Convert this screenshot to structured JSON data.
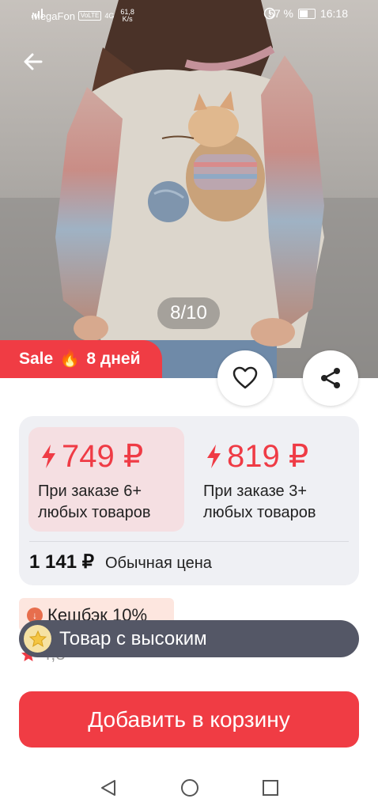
{
  "status_bar": {
    "carrier": "MegaFon",
    "volte": "VoLTE",
    "network": "4G",
    "speed_value": "61,8",
    "speed_unit": "K/s",
    "battery": "57 %",
    "time": "16:18"
  },
  "gallery": {
    "counter": "8/10"
  },
  "sale_badge": {
    "label": "Sale",
    "emoji": "🔥",
    "duration": "8 дней"
  },
  "price_tiers": [
    {
      "price": "749 ₽",
      "condition_line1": "При заказе 6+",
      "condition_line2": "любых товаров",
      "selected": true
    },
    {
      "price": "819 ₽",
      "condition_line1": "При заказе 3+",
      "condition_line2": "любых товаров",
      "selected": false
    }
  ],
  "regular_price": {
    "value": "1 141 ₽",
    "label": "Обычная цена"
  },
  "cashback": {
    "label": "Кешбэк 10%"
  },
  "rating": {
    "value": "4,8"
  },
  "toast": {
    "text": "Товар с высоким"
  },
  "add_to_cart": {
    "label": "Добавить в корзину"
  },
  "colors": {
    "accent": "#f03c44",
    "toast_bg": "#545766",
    "panel_bg": "#eff0f4"
  },
  "icons": [
    "back-arrow-icon",
    "heart-icon",
    "share-icon",
    "lightning-icon",
    "star-icon",
    "nav-back-icon",
    "nav-home-icon",
    "nav-recents-icon"
  ]
}
